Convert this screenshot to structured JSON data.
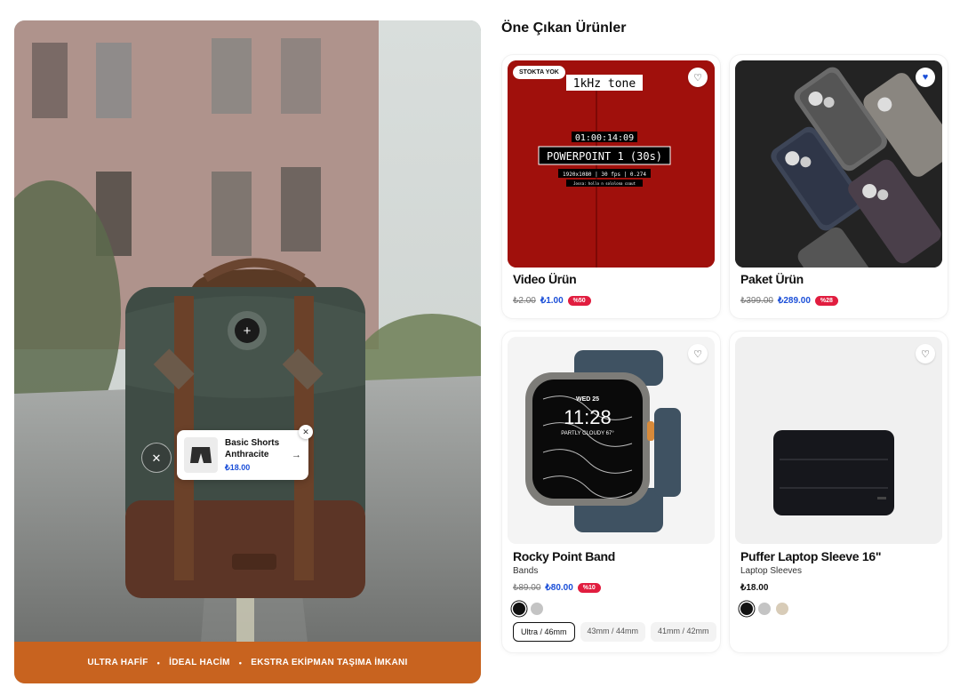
{
  "hero": {
    "features": [
      "ULTRA HAFİF",
      "İDEAL HACİM",
      "EKSTRA EKİPMAN TAŞIMA İMKANI"
    ],
    "separator": "•",
    "hotspot_plus": "+",
    "hotspot_close": "✕",
    "popup": {
      "name_line1": "Basic Shorts",
      "name_line2": "Anthracite",
      "price": "₺18.00",
      "arrow": "→",
      "close": "✕"
    }
  },
  "section": {
    "title": "Öne Çıkan Ürünler"
  },
  "products": [
    {
      "title": "Video Ürün",
      "badge": "STOKTA YOK",
      "old_price": "₺2.00",
      "price": "₺1.00",
      "discount": "%50",
      "favorite": false,
      "media_text": {
        "tone": "1kHz tone",
        "time": "01:00:14:09",
        "label": "POWERPOINT 1 (30s)",
        "meta": "1920x1080 | 30 fps | 0.274",
        "small": "Jossa: hollo n  sololona coaut"
      }
    },
    {
      "title": "Paket Ürün",
      "old_price": "₺399.00",
      "price": "₺289.00",
      "discount": "%28",
      "favorite": true
    },
    {
      "title": "Rocky Point Band",
      "subtitle": "Bands",
      "old_price": "₺89.00",
      "price": "₺80.00",
      "discount": "%10",
      "favorite": false,
      "watch": {
        "day": "WED 25",
        "time": "11:28",
        "weather": "PARTLY CLOUDY 67°"
      },
      "swatches": [
        "#111111",
        "#c4c4c4"
      ],
      "sizes": [
        "Ultra / 46mm",
        "43mm / 44mm",
        "41mm / 42mm"
      ]
    },
    {
      "title": "Puffer Laptop Sleeve 16\"",
      "subtitle": "Laptop Sleeves",
      "price": "₺18.00",
      "favorite": false,
      "swatches": [
        "#111111",
        "#c4c4c4",
        "#d8ccb8"
      ]
    }
  ],
  "icons": {
    "heart_empty": "♡",
    "heart_filled": "♥"
  }
}
